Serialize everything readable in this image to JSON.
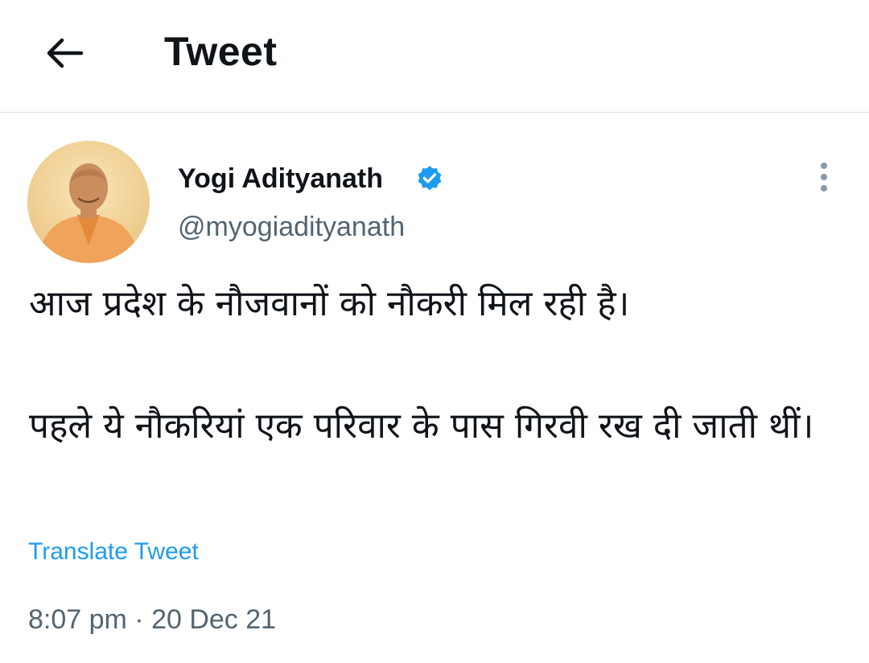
{
  "header": {
    "title": "Tweet",
    "back_icon": "arrow-left-icon"
  },
  "tweet": {
    "author": {
      "display_name": "Yogi Adityanath",
      "handle": "@myogiadityanath",
      "verified": true,
      "verified_icon": "verified-badge-icon",
      "avatar_icon": "avatar"
    },
    "text": "आज प्रदेश के नौजवानों को नौकरी मिल रही है।\n\nपहले ये नौकरियां एक परिवार के पास गिरवी रख दी जाती थीं।",
    "translate_label": "Translate Tweet",
    "time": "8:07 pm",
    "separator": " · ",
    "date": "20 Dec 21",
    "more_icon": "more-vertical-icon"
  },
  "colors": {
    "link": "#1d9bf0",
    "muted": "#536471",
    "text": "#0f1419",
    "divider": "#e1e4e7"
  }
}
